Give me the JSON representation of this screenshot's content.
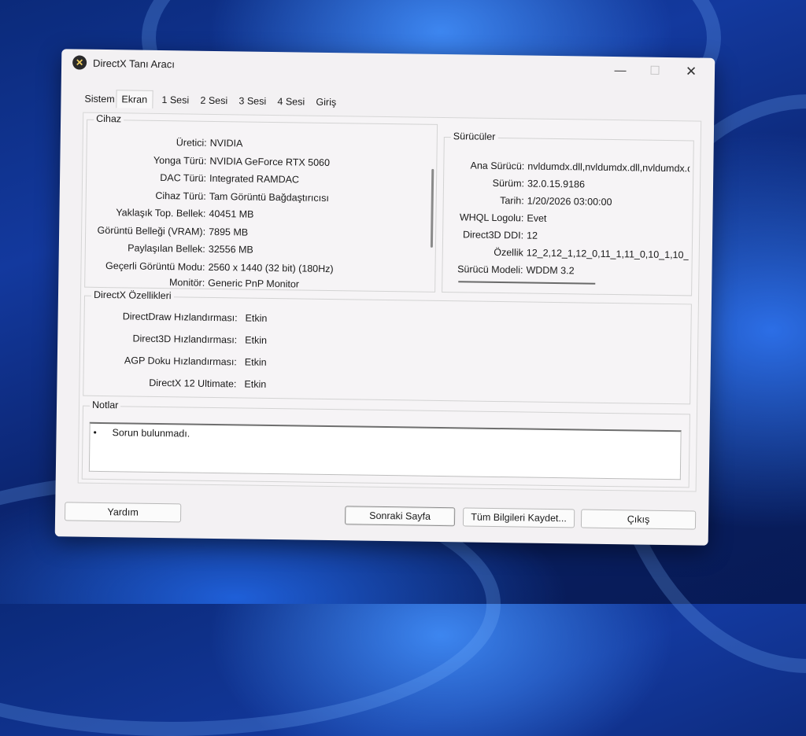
{
  "window": {
    "title": "DirectX Tanı Aracı",
    "minimize": "—",
    "maximize": "☐",
    "close": "✕"
  },
  "tabs": [
    "Sistem",
    "Ekran",
    "1 Sesi",
    "2 Sesi",
    "3 Sesi",
    "4 Sesi",
    "Giriş"
  ],
  "device": {
    "title": "Cihaz",
    "rows": [
      {
        "label": "Üretici:",
        "value": "NVIDIA"
      },
      {
        "label": "Yonga Türü:",
        "value": "NVIDIA GeForce RTX 5060"
      },
      {
        "label": "DAC Türü:",
        "value": "Integrated RAMDAC"
      },
      {
        "label": "Cihaz Türü:",
        "value": "Tam Görüntü Bağdaştırıcısı"
      },
      {
        "label": "Yaklaşık Top. Bellek:",
        "value": "40451 MB"
      },
      {
        "label": "Görüntü Belleği (VRAM):",
        "value": "7895 MB"
      },
      {
        "label": "Paylaşılan Bellek:",
        "value": "32556 MB"
      },
      {
        "label": "Geçerli Görüntü Modu:",
        "value": "2560 x 1440 (32 bit) (180Hz)"
      },
      {
        "label": "Monitör:",
        "value": "Generic PnP Monitor"
      }
    ]
  },
  "drivers": {
    "title": "Sürücüler",
    "rows": [
      {
        "label": "Ana Sürücü:",
        "value": "nvldumdx.dll,nvldumdx.dll,nvldumdx.d"
      },
      {
        "label": "Sürüm:",
        "value": "32.0.15.9186"
      },
      {
        "label": "Tarih:",
        "value": "1/20/2026 03:00:00"
      },
      {
        "label": "WHQL Logolu:",
        "value": "Evet"
      },
      {
        "label": "Direct3D DDI:",
        "value": "12"
      },
      {
        "label": "Özellik",
        "value": "12_2,12_1,12_0,11_1,11_0,10_1,10_"
      },
      {
        "label": "Sürücü Modeli:",
        "value": "WDDM 3.2"
      }
    ]
  },
  "features": {
    "title": "DirectX Özellikleri",
    "rows": [
      {
        "label": "DirectDraw Hızlandırması:",
        "value": "Etkin"
      },
      {
        "label": "Direct3D Hızlandırması:",
        "value": "Etkin"
      },
      {
        "label": "AGP Doku Hızlandırması:",
        "value": "Etkin"
      },
      {
        "label": "DirectX 12 Ultimate:",
        "value": "Etkin"
      }
    ]
  },
  "notes": {
    "title": "Notlar",
    "bullet": "•",
    "items": [
      "Sorun bulunmadı."
    ]
  },
  "buttons": {
    "help": "Yardım",
    "next": "Sonraki Sayfa",
    "save_all": "Tüm Bilgileri Kaydet...",
    "exit": "Çıkış"
  }
}
